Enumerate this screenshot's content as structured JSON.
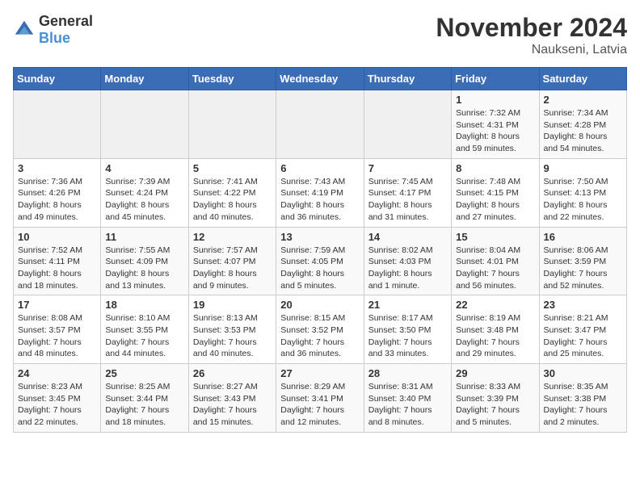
{
  "logo": {
    "text_general": "General",
    "text_blue": "Blue"
  },
  "title": "November 2024",
  "subtitle": "Naukseni, Latvia",
  "days_of_week": [
    "Sunday",
    "Monday",
    "Tuesday",
    "Wednesday",
    "Thursday",
    "Friday",
    "Saturday"
  ],
  "weeks": [
    [
      {
        "day": "",
        "info": ""
      },
      {
        "day": "",
        "info": ""
      },
      {
        "day": "",
        "info": ""
      },
      {
        "day": "",
        "info": ""
      },
      {
        "day": "",
        "info": ""
      },
      {
        "day": "1",
        "info": "Sunrise: 7:32 AM\nSunset: 4:31 PM\nDaylight: 8 hours and 59 minutes."
      },
      {
        "day": "2",
        "info": "Sunrise: 7:34 AM\nSunset: 4:28 PM\nDaylight: 8 hours and 54 minutes."
      }
    ],
    [
      {
        "day": "3",
        "info": "Sunrise: 7:36 AM\nSunset: 4:26 PM\nDaylight: 8 hours and 49 minutes."
      },
      {
        "day": "4",
        "info": "Sunrise: 7:39 AM\nSunset: 4:24 PM\nDaylight: 8 hours and 45 minutes."
      },
      {
        "day": "5",
        "info": "Sunrise: 7:41 AM\nSunset: 4:22 PM\nDaylight: 8 hours and 40 minutes."
      },
      {
        "day": "6",
        "info": "Sunrise: 7:43 AM\nSunset: 4:19 PM\nDaylight: 8 hours and 36 minutes."
      },
      {
        "day": "7",
        "info": "Sunrise: 7:45 AM\nSunset: 4:17 PM\nDaylight: 8 hours and 31 minutes."
      },
      {
        "day": "8",
        "info": "Sunrise: 7:48 AM\nSunset: 4:15 PM\nDaylight: 8 hours and 27 minutes."
      },
      {
        "day": "9",
        "info": "Sunrise: 7:50 AM\nSunset: 4:13 PM\nDaylight: 8 hours and 22 minutes."
      }
    ],
    [
      {
        "day": "10",
        "info": "Sunrise: 7:52 AM\nSunset: 4:11 PM\nDaylight: 8 hours and 18 minutes."
      },
      {
        "day": "11",
        "info": "Sunrise: 7:55 AM\nSunset: 4:09 PM\nDaylight: 8 hours and 13 minutes."
      },
      {
        "day": "12",
        "info": "Sunrise: 7:57 AM\nSunset: 4:07 PM\nDaylight: 8 hours and 9 minutes."
      },
      {
        "day": "13",
        "info": "Sunrise: 7:59 AM\nSunset: 4:05 PM\nDaylight: 8 hours and 5 minutes."
      },
      {
        "day": "14",
        "info": "Sunrise: 8:02 AM\nSunset: 4:03 PM\nDaylight: 8 hours and 1 minute."
      },
      {
        "day": "15",
        "info": "Sunrise: 8:04 AM\nSunset: 4:01 PM\nDaylight: 7 hours and 56 minutes."
      },
      {
        "day": "16",
        "info": "Sunrise: 8:06 AM\nSunset: 3:59 PM\nDaylight: 7 hours and 52 minutes."
      }
    ],
    [
      {
        "day": "17",
        "info": "Sunrise: 8:08 AM\nSunset: 3:57 PM\nDaylight: 7 hours and 48 minutes."
      },
      {
        "day": "18",
        "info": "Sunrise: 8:10 AM\nSunset: 3:55 PM\nDaylight: 7 hours and 44 minutes."
      },
      {
        "day": "19",
        "info": "Sunrise: 8:13 AM\nSunset: 3:53 PM\nDaylight: 7 hours and 40 minutes."
      },
      {
        "day": "20",
        "info": "Sunrise: 8:15 AM\nSunset: 3:52 PM\nDaylight: 7 hours and 36 minutes."
      },
      {
        "day": "21",
        "info": "Sunrise: 8:17 AM\nSunset: 3:50 PM\nDaylight: 7 hours and 33 minutes."
      },
      {
        "day": "22",
        "info": "Sunrise: 8:19 AM\nSunset: 3:48 PM\nDaylight: 7 hours and 29 minutes."
      },
      {
        "day": "23",
        "info": "Sunrise: 8:21 AM\nSunset: 3:47 PM\nDaylight: 7 hours and 25 minutes."
      }
    ],
    [
      {
        "day": "24",
        "info": "Sunrise: 8:23 AM\nSunset: 3:45 PM\nDaylight: 7 hours and 22 minutes."
      },
      {
        "day": "25",
        "info": "Sunrise: 8:25 AM\nSunset: 3:44 PM\nDaylight: 7 hours and 18 minutes."
      },
      {
        "day": "26",
        "info": "Sunrise: 8:27 AM\nSunset: 3:43 PM\nDaylight: 7 hours and 15 minutes."
      },
      {
        "day": "27",
        "info": "Sunrise: 8:29 AM\nSunset: 3:41 PM\nDaylight: 7 hours and 12 minutes."
      },
      {
        "day": "28",
        "info": "Sunrise: 8:31 AM\nSunset: 3:40 PM\nDaylight: 7 hours and 8 minutes."
      },
      {
        "day": "29",
        "info": "Sunrise: 8:33 AM\nSunset: 3:39 PM\nDaylight: 7 hours and 5 minutes."
      },
      {
        "day": "30",
        "info": "Sunrise: 8:35 AM\nSunset: 3:38 PM\nDaylight: 7 hours and 2 minutes."
      }
    ]
  ]
}
